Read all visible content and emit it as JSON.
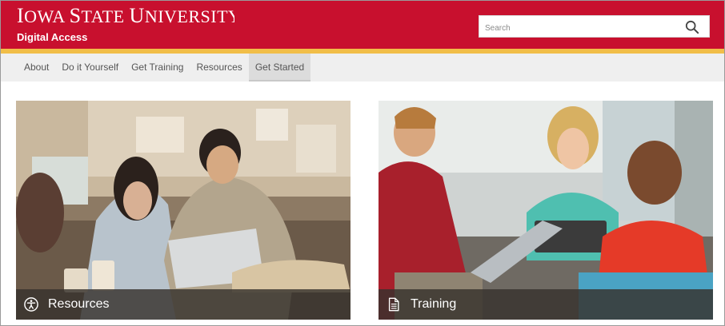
{
  "header": {
    "university": "Iowa State University",
    "unit": "Digital Access",
    "brand_red": "#c8102e",
    "brand_gold": "#f1be48"
  },
  "search": {
    "placeholder": "Search",
    "icon": "search-icon"
  },
  "nav": {
    "items": [
      {
        "label": "About"
      },
      {
        "label": "Do it Yourself"
      },
      {
        "label": "Get Training"
      },
      {
        "label": "Resources"
      },
      {
        "label": "Get Started",
        "active": true
      }
    ]
  },
  "cards": [
    {
      "label": "Resources",
      "icon": "accessibility-icon"
    },
    {
      "label": "Training",
      "icon": "document-icon"
    }
  ]
}
